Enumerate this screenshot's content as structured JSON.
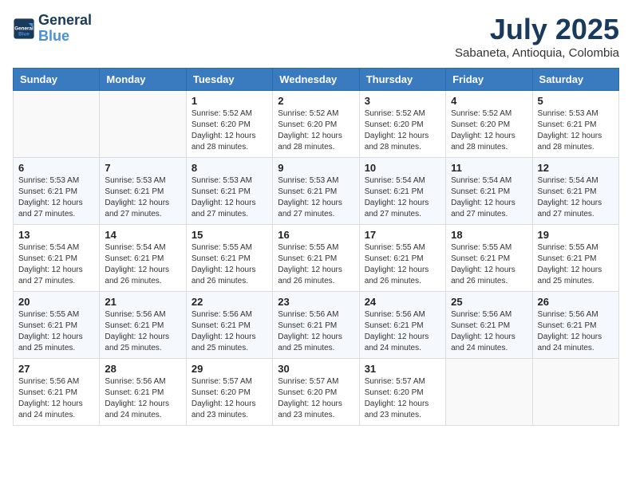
{
  "header": {
    "logo_general": "General",
    "logo_blue": "Blue",
    "month_year": "July 2025",
    "location": "Sabaneta, Antioquia, Colombia"
  },
  "weekdays": [
    "Sunday",
    "Monday",
    "Tuesday",
    "Wednesday",
    "Thursday",
    "Friday",
    "Saturday"
  ],
  "weeks": [
    [
      {
        "day": "",
        "info": ""
      },
      {
        "day": "",
        "info": ""
      },
      {
        "day": "1",
        "sunrise": "5:52 AM",
        "sunset": "6:20 PM",
        "daylight": "12 hours and 28 minutes."
      },
      {
        "day": "2",
        "sunrise": "5:52 AM",
        "sunset": "6:20 PM",
        "daylight": "12 hours and 28 minutes."
      },
      {
        "day": "3",
        "sunrise": "5:52 AM",
        "sunset": "6:20 PM",
        "daylight": "12 hours and 28 minutes."
      },
      {
        "day": "4",
        "sunrise": "5:52 AM",
        "sunset": "6:20 PM",
        "daylight": "12 hours and 28 minutes."
      },
      {
        "day": "5",
        "sunrise": "5:53 AM",
        "sunset": "6:21 PM",
        "daylight": "12 hours and 28 minutes."
      }
    ],
    [
      {
        "day": "6",
        "sunrise": "5:53 AM",
        "sunset": "6:21 PM",
        "daylight": "12 hours and 27 minutes."
      },
      {
        "day": "7",
        "sunrise": "5:53 AM",
        "sunset": "6:21 PM",
        "daylight": "12 hours and 27 minutes."
      },
      {
        "day": "8",
        "sunrise": "5:53 AM",
        "sunset": "6:21 PM",
        "daylight": "12 hours and 27 minutes."
      },
      {
        "day": "9",
        "sunrise": "5:53 AM",
        "sunset": "6:21 PM",
        "daylight": "12 hours and 27 minutes."
      },
      {
        "day": "10",
        "sunrise": "5:54 AM",
        "sunset": "6:21 PM",
        "daylight": "12 hours and 27 minutes."
      },
      {
        "day": "11",
        "sunrise": "5:54 AM",
        "sunset": "6:21 PM",
        "daylight": "12 hours and 27 minutes."
      },
      {
        "day": "12",
        "sunrise": "5:54 AM",
        "sunset": "6:21 PM",
        "daylight": "12 hours and 27 minutes."
      }
    ],
    [
      {
        "day": "13",
        "sunrise": "5:54 AM",
        "sunset": "6:21 PM",
        "daylight": "12 hours and 27 minutes."
      },
      {
        "day": "14",
        "sunrise": "5:54 AM",
        "sunset": "6:21 PM",
        "daylight": "12 hours and 26 minutes."
      },
      {
        "day": "15",
        "sunrise": "5:55 AM",
        "sunset": "6:21 PM",
        "daylight": "12 hours and 26 minutes."
      },
      {
        "day": "16",
        "sunrise": "5:55 AM",
        "sunset": "6:21 PM",
        "daylight": "12 hours and 26 minutes."
      },
      {
        "day": "17",
        "sunrise": "5:55 AM",
        "sunset": "6:21 PM",
        "daylight": "12 hours and 26 minutes."
      },
      {
        "day": "18",
        "sunrise": "5:55 AM",
        "sunset": "6:21 PM",
        "daylight": "12 hours and 26 minutes."
      },
      {
        "day": "19",
        "sunrise": "5:55 AM",
        "sunset": "6:21 PM",
        "daylight": "12 hours and 25 minutes."
      }
    ],
    [
      {
        "day": "20",
        "sunrise": "5:55 AM",
        "sunset": "6:21 PM",
        "daylight": "12 hours and 25 minutes."
      },
      {
        "day": "21",
        "sunrise": "5:56 AM",
        "sunset": "6:21 PM",
        "daylight": "12 hours and 25 minutes."
      },
      {
        "day": "22",
        "sunrise": "5:56 AM",
        "sunset": "6:21 PM",
        "daylight": "12 hours and 25 minutes."
      },
      {
        "day": "23",
        "sunrise": "5:56 AM",
        "sunset": "6:21 PM",
        "daylight": "12 hours and 25 minutes."
      },
      {
        "day": "24",
        "sunrise": "5:56 AM",
        "sunset": "6:21 PM",
        "daylight": "12 hours and 24 minutes."
      },
      {
        "day": "25",
        "sunrise": "5:56 AM",
        "sunset": "6:21 PM",
        "daylight": "12 hours and 24 minutes."
      },
      {
        "day": "26",
        "sunrise": "5:56 AM",
        "sunset": "6:21 PM",
        "daylight": "12 hours and 24 minutes."
      }
    ],
    [
      {
        "day": "27",
        "sunrise": "5:56 AM",
        "sunset": "6:21 PM",
        "daylight": "12 hours and 24 minutes."
      },
      {
        "day": "28",
        "sunrise": "5:56 AM",
        "sunset": "6:21 PM",
        "daylight": "12 hours and 24 minutes."
      },
      {
        "day": "29",
        "sunrise": "5:57 AM",
        "sunset": "6:20 PM",
        "daylight": "12 hours and 23 minutes."
      },
      {
        "day": "30",
        "sunrise": "5:57 AM",
        "sunset": "6:20 PM",
        "daylight": "12 hours and 23 minutes."
      },
      {
        "day": "31",
        "sunrise": "5:57 AM",
        "sunset": "6:20 PM",
        "daylight": "12 hours and 23 minutes."
      },
      {
        "day": "",
        "info": ""
      },
      {
        "day": "",
        "info": ""
      }
    ]
  ],
  "labels": {
    "sunrise": "Sunrise:",
    "sunset": "Sunset:",
    "daylight": "Daylight: 12 hours"
  }
}
